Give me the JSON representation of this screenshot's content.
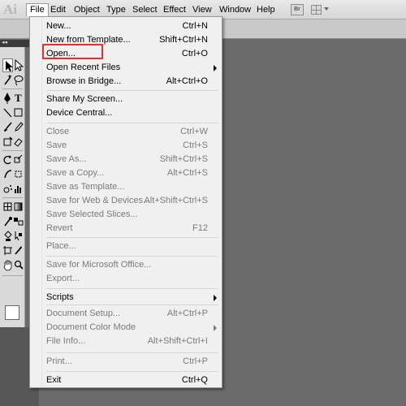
{
  "app": {
    "logo_text": "Ai"
  },
  "menubar": {
    "items": [
      "File",
      "Edit",
      "Object",
      "Type",
      "Select",
      "Effect",
      "View",
      "Window",
      "Help"
    ],
    "active": "File",
    "bridge_button": "Br"
  },
  "tools_panel": {
    "collapse_arrows": "◂◂"
  },
  "file_menu": {
    "items": [
      {
        "label": "New...",
        "shortcut": "Ctrl+N",
        "enabled": true
      },
      {
        "label": "New from Template...",
        "shortcut": "Shift+Ctrl+N",
        "enabled": true
      },
      {
        "label": "Open...",
        "shortcut": "Ctrl+O",
        "enabled": true,
        "highlighted": true
      },
      {
        "label": "Open Recent Files",
        "shortcut": "",
        "enabled": true,
        "submenu": true
      },
      {
        "label": "Browse in Bridge...",
        "shortcut": "Alt+Ctrl+O",
        "enabled": true
      },
      {
        "label": "Share My Screen...",
        "shortcut": "",
        "enabled": true
      },
      {
        "label": "Device Central...",
        "shortcut": "",
        "enabled": true
      },
      {
        "label": "Close",
        "shortcut": "Ctrl+W",
        "enabled": false
      },
      {
        "label": "Save",
        "shortcut": "Ctrl+S",
        "enabled": false
      },
      {
        "label": "Save As...",
        "shortcut": "Shift+Ctrl+S",
        "enabled": false
      },
      {
        "label": "Save a Copy...",
        "shortcut": "Alt+Ctrl+S",
        "enabled": false
      },
      {
        "label": "Save as Template...",
        "shortcut": "",
        "enabled": false
      },
      {
        "label": "Save for Web & Devices...",
        "shortcut": "Alt+Shift+Ctrl+S",
        "enabled": false
      },
      {
        "label": "Save Selected Slices...",
        "shortcut": "",
        "enabled": false
      },
      {
        "label": "Revert",
        "shortcut": "F12",
        "enabled": false
      },
      {
        "label": "Place...",
        "shortcut": "",
        "enabled": false
      },
      {
        "label": "Save for Microsoft Office...",
        "shortcut": "",
        "enabled": false
      },
      {
        "label": "Export...",
        "shortcut": "",
        "enabled": false
      },
      {
        "label": "Scripts",
        "shortcut": "",
        "enabled": true,
        "submenu": true
      },
      {
        "label": "Document Setup...",
        "shortcut": "Alt+Ctrl+P",
        "enabled": false
      },
      {
        "label": "Document Color Mode",
        "shortcut": "",
        "enabled": false,
        "submenu": true
      },
      {
        "label": "File Info...",
        "shortcut": "Alt+Shift+Ctrl+I",
        "enabled": false
      },
      {
        "label": "Print...",
        "shortcut": "Ctrl+P",
        "enabled": false
      },
      {
        "label": "Exit",
        "shortcut": "Ctrl+Q",
        "enabled": true
      }
    ]
  },
  "colors": {
    "highlight_box": "#e0312f",
    "background": "#6b6b6b",
    "disabled_text": "#7a7a7a",
    "stroke_swatch": "#1d7a2e"
  }
}
